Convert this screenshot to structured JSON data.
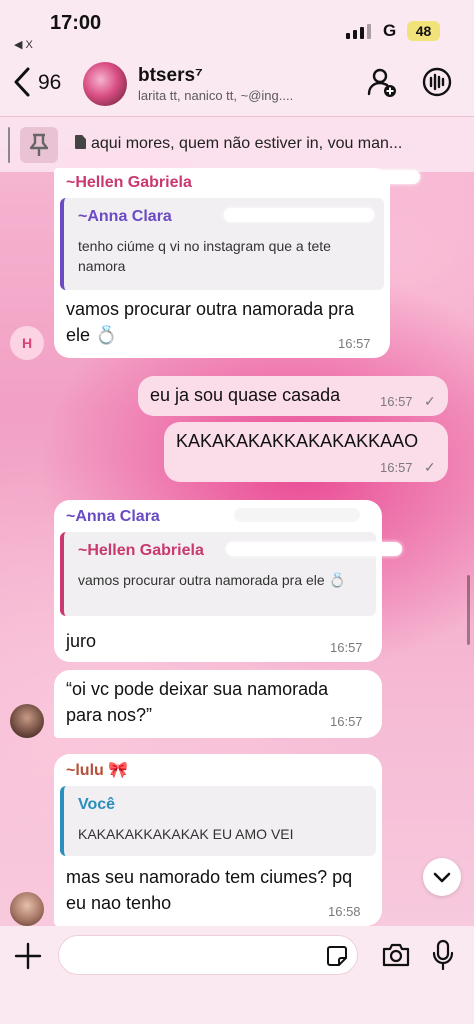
{
  "status_bar": {
    "time": "17:00",
    "back_app": "◀ X",
    "carrier": "G",
    "battery": "48"
  },
  "header": {
    "back_count": "96",
    "group_name": "btsers⁷",
    "members": "larita tt, nanico tt, ~@ing...."
  },
  "pinned": {
    "text": "aqui mores, quem não estiver in, vou man..."
  },
  "messages": [
    {
      "sender": "~Hellen Gabriela",
      "reply_name": "~Anna Clara",
      "reply_text": "tenho ciúme q vi no instagram que a tete namora",
      "text": "vamos procurar outra namorada pra ele 💍",
      "time": "16:57",
      "avatar_letter": "H"
    },
    {
      "text": "eu ja sou quase casada",
      "time": "16:57",
      "check": "✓"
    },
    {
      "text": "KAKAKAKAKKAKAKAKKAAO",
      "time": "16:57",
      "check": "✓"
    },
    {
      "sender": "~Anna Clara",
      "reply_name": "~Hellen Gabriela",
      "reply_text": "vamos procurar outra namorada pra ele 💍",
      "text": "juro",
      "time": "16:57"
    },
    {
      "text": "“oi vc pode deixar sua namorada para nos?”",
      "time": "16:57"
    },
    {
      "sender": "~lulu 🎀",
      "reply_name": "Você",
      "reply_text": "KAKAKAKKAKAKAK EU AMO VEI",
      "text": "mas seu namorado tem ciumes? pq eu nao tenho",
      "time": "16:58"
    }
  ],
  "colors": {
    "hellen": "#c9386f",
    "anna": "#6a4bc3",
    "lulu": "#b5503a",
    "voce": "#2a8fbd"
  },
  "icons": [
    "back-chevron-icon",
    "add-person-icon",
    "group-call-icon",
    "pin-icon",
    "document-icon",
    "chevron-down-icon",
    "plus-icon",
    "sticker-icon",
    "camera-icon",
    "microphone-icon"
  ]
}
